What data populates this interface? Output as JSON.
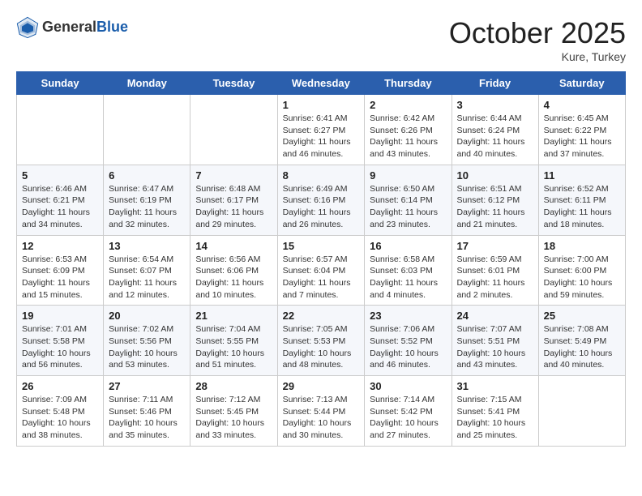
{
  "logo": {
    "general": "General",
    "blue": "Blue"
  },
  "title": "October 2025",
  "location": "Kure, Turkey",
  "days_of_week": [
    "Sunday",
    "Monday",
    "Tuesday",
    "Wednesday",
    "Thursday",
    "Friday",
    "Saturday"
  ],
  "weeks": [
    [
      {
        "day": "",
        "info": ""
      },
      {
        "day": "",
        "info": ""
      },
      {
        "day": "",
        "info": ""
      },
      {
        "day": "1",
        "info": "Sunrise: 6:41 AM\nSunset: 6:27 PM\nDaylight: 11 hours\nand 46 minutes."
      },
      {
        "day": "2",
        "info": "Sunrise: 6:42 AM\nSunset: 6:26 PM\nDaylight: 11 hours\nand 43 minutes."
      },
      {
        "day": "3",
        "info": "Sunrise: 6:44 AM\nSunset: 6:24 PM\nDaylight: 11 hours\nand 40 minutes."
      },
      {
        "day": "4",
        "info": "Sunrise: 6:45 AM\nSunset: 6:22 PM\nDaylight: 11 hours\nand 37 minutes."
      }
    ],
    [
      {
        "day": "5",
        "info": "Sunrise: 6:46 AM\nSunset: 6:21 PM\nDaylight: 11 hours\nand 34 minutes."
      },
      {
        "day": "6",
        "info": "Sunrise: 6:47 AM\nSunset: 6:19 PM\nDaylight: 11 hours\nand 32 minutes."
      },
      {
        "day": "7",
        "info": "Sunrise: 6:48 AM\nSunset: 6:17 PM\nDaylight: 11 hours\nand 29 minutes."
      },
      {
        "day": "8",
        "info": "Sunrise: 6:49 AM\nSunset: 6:16 PM\nDaylight: 11 hours\nand 26 minutes."
      },
      {
        "day": "9",
        "info": "Sunrise: 6:50 AM\nSunset: 6:14 PM\nDaylight: 11 hours\nand 23 minutes."
      },
      {
        "day": "10",
        "info": "Sunrise: 6:51 AM\nSunset: 6:12 PM\nDaylight: 11 hours\nand 21 minutes."
      },
      {
        "day": "11",
        "info": "Sunrise: 6:52 AM\nSunset: 6:11 PM\nDaylight: 11 hours\nand 18 minutes."
      }
    ],
    [
      {
        "day": "12",
        "info": "Sunrise: 6:53 AM\nSunset: 6:09 PM\nDaylight: 11 hours\nand 15 minutes."
      },
      {
        "day": "13",
        "info": "Sunrise: 6:54 AM\nSunset: 6:07 PM\nDaylight: 11 hours\nand 12 minutes."
      },
      {
        "day": "14",
        "info": "Sunrise: 6:56 AM\nSunset: 6:06 PM\nDaylight: 11 hours\nand 10 minutes."
      },
      {
        "day": "15",
        "info": "Sunrise: 6:57 AM\nSunset: 6:04 PM\nDaylight: 11 hours\nand 7 minutes."
      },
      {
        "day": "16",
        "info": "Sunrise: 6:58 AM\nSunset: 6:03 PM\nDaylight: 11 hours\nand 4 minutes."
      },
      {
        "day": "17",
        "info": "Sunrise: 6:59 AM\nSunset: 6:01 PM\nDaylight: 11 hours\nand 2 minutes."
      },
      {
        "day": "18",
        "info": "Sunrise: 7:00 AM\nSunset: 6:00 PM\nDaylight: 10 hours\nand 59 minutes."
      }
    ],
    [
      {
        "day": "19",
        "info": "Sunrise: 7:01 AM\nSunset: 5:58 PM\nDaylight: 10 hours\nand 56 minutes."
      },
      {
        "day": "20",
        "info": "Sunrise: 7:02 AM\nSunset: 5:56 PM\nDaylight: 10 hours\nand 53 minutes."
      },
      {
        "day": "21",
        "info": "Sunrise: 7:04 AM\nSunset: 5:55 PM\nDaylight: 10 hours\nand 51 minutes."
      },
      {
        "day": "22",
        "info": "Sunrise: 7:05 AM\nSunset: 5:53 PM\nDaylight: 10 hours\nand 48 minutes."
      },
      {
        "day": "23",
        "info": "Sunrise: 7:06 AM\nSunset: 5:52 PM\nDaylight: 10 hours\nand 46 minutes."
      },
      {
        "day": "24",
        "info": "Sunrise: 7:07 AM\nSunset: 5:51 PM\nDaylight: 10 hours\nand 43 minutes."
      },
      {
        "day": "25",
        "info": "Sunrise: 7:08 AM\nSunset: 5:49 PM\nDaylight: 10 hours\nand 40 minutes."
      }
    ],
    [
      {
        "day": "26",
        "info": "Sunrise: 7:09 AM\nSunset: 5:48 PM\nDaylight: 10 hours\nand 38 minutes."
      },
      {
        "day": "27",
        "info": "Sunrise: 7:11 AM\nSunset: 5:46 PM\nDaylight: 10 hours\nand 35 minutes."
      },
      {
        "day": "28",
        "info": "Sunrise: 7:12 AM\nSunset: 5:45 PM\nDaylight: 10 hours\nand 33 minutes."
      },
      {
        "day": "29",
        "info": "Sunrise: 7:13 AM\nSunset: 5:44 PM\nDaylight: 10 hours\nand 30 minutes."
      },
      {
        "day": "30",
        "info": "Sunrise: 7:14 AM\nSunset: 5:42 PM\nDaylight: 10 hours\nand 27 minutes."
      },
      {
        "day": "31",
        "info": "Sunrise: 7:15 AM\nSunset: 5:41 PM\nDaylight: 10 hours\nand 25 minutes."
      },
      {
        "day": "",
        "info": ""
      }
    ]
  ]
}
